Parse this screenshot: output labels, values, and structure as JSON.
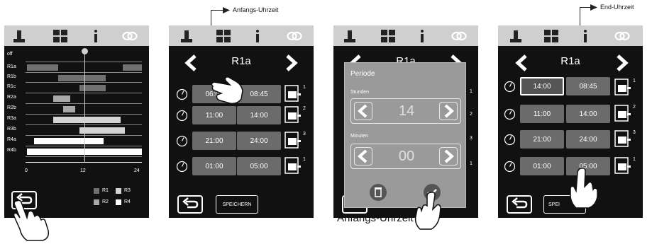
{
  "colors": {
    "screen_bg": "#111111",
    "topbar_bg": "#cfcfcf",
    "time_button": "#6b6b6b",
    "dialog_bg": "#9a9a9a",
    "bar_r1": "#707070",
    "bar_r2": "#a8a8a8",
    "bar_r3": "#d4d4d4",
    "bar_r4": "#ffffff"
  },
  "icons": {
    "topbar": [
      "thermometer-icon",
      "grid-icon",
      "info-icon",
      "link-icon"
    ],
    "prev": "chevron-left-icon",
    "next": "chevron-right-icon",
    "clock": "clock-icon",
    "program": "program-icon",
    "back": "back-icon",
    "delete": "trash-icon",
    "confirm": "check-icon"
  },
  "callouts": {
    "start_time": "Anfangs-Uhrzeit",
    "end_time": "End-Uhrzeit",
    "bottom_caption": "Anfangs-Uhrzeit"
  },
  "panel1": {
    "row_labels": [
      "off",
      "R1a",
      "R1b",
      "R1c",
      "R2a",
      "R2b",
      "R3a",
      "R3b",
      "R4a",
      "R4b"
    ],
    "axis_ticks": [
      "0",
      "12",
      "24"
    ],
    "legend": [
      {
        "label": "R1",
        "color": "#707070"
      },
      {
        "label": "R2",
        "color": "#a8a8a8"
      },
      {
        "label": "R3",
        "color": "#d4d4d4"
      },
      {
        "label": "R4",
        "color": "#ffffff"
      }
    ],
    "schedule": [
      {
        "row": "R1a",
        "start": 0,
        "end": 6.5,
        "color": "#707070"
      },
      {
        "row": "R1a",
        "start": 20,
        "end": 24,
        "color": "#707070"
      },
      {
        "row": "R1b",
        "start": 6.5,
        "end": 16.5,
        "color": "#707070"
      },
      {
        "row": "R1c",
        "start": 11,
        "end": 16.5,
        "color": "#707070"
      },
      {
        "row": "R2a",
        "start": 5.5,
        "end": 9,
        "color": "#a8a8a8"
      },
      {
        "row": "R2b",
        "start": 7.5,
        "end": 10,
        "color": "#a8a8a8"
      },
      {
        "row": "R3a",
        "start": 5.5,
        "end": 19.5,
        "color": "#d4d4d4"
      },
      {
        "row": "R3b",
        "start": 11,
        "end": 20.5,
        "color": "#d4d4d4"
      },
      {
        "row": "R4a",
        "start": 1.5,
        "end": 16,
        "color": "#ffffff"
      },
      {
        "row": "R4b",
        "start": 0,
        "end": 24,
        "color": "#ffffff"
      }
    ],
    "current_hour": 12
  },
  "panel2": {
    "title": "R1a",
    "rows": [
      {
        "start": "06:00",
        "end": "08:45",
        "program": "1"
      },
      {
        "start": "11:00",
        "end": "14:00",
        "program": "2"
      },
      {
        "start": "21:00",
        "end": "24:00",
        "program": "3"
      },
      {
        "start": "01:00",
        "end": "05:00",
        "program": "1"
      }
    ],
    "save_label": "SPEICHERN"
  },
  "panel3": {
    "title": "R1a",
    "dialog_title": "Periode",
    "hours_label": "Stunden",
    "hours_value": "14",
    "minutes_label": "Minuten",
    "minutes_value": "00",
    "side_numbers": [
      "1",
      "2",
      "3",
      "1"
    ]
  },
  "panel4": {
    "title": "R1a",
    "rows": [
      {
        "start": "14:00",
        "end": "08:45",
        "program": "1"
      },
      {
        "start": "11:00",
        "end": "14:00",
        "program": "2"
      },
      {
        "start": "21:00",
        "end": "24:00",
        "program": "3"
      },
      {
        "start": "01:00",
        "end": "05:00",
        "program": "1"
      }
    ],
    "save_label": "SPEI"
  }
}
